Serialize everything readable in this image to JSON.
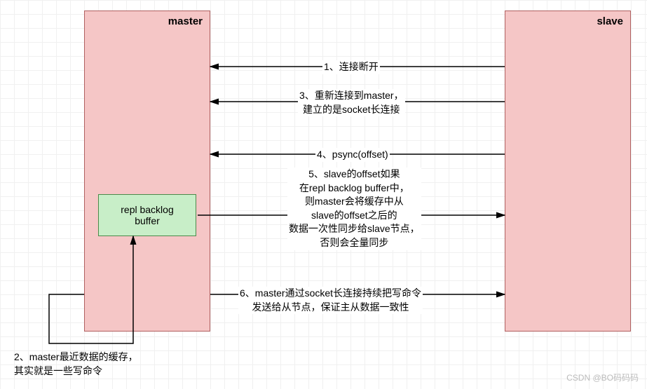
{
  "master": {
    "title": "master"
  },
  "slave": {
    "title": "slave"
  },
  "buffer": {
    "label": "repl backlog\nbuffer"
  },
  "steps": {
    "s1": "1、连接断开",
    "s3": "3、重新连接到master，\n建立的是socket长连接",
    "s4": "4、psync(offset)",
    "s5": "5、slave的offset如果\n在repl backlog buffer中，\n则master会将缓存中从\nslave的offset之后的\n数据一次性同步给slave节点，\n否则会全量同步",
    "s6": "6、master通过socket长连接持续把写命令\n发送给从节点，保证主从数据一致性",
    "s2": "2、master最近数据的缓存，\n其实就是一些写命令"
  },
  "watermark": "CSDN @BO码码码"
}
